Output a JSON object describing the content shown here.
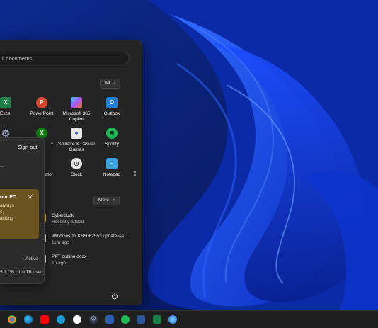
{
  "search": {
    "text": "ll documents"
  },
  "pinned": {
    "all_label": "All",
    "apps": [
      {
        "label": "Excel"
      },
      {
        "label": "PowerPoint"
      },
      {
        "label": "Microsoft 365 Copilot"
      },
      {
        "label": "Outlook"
      },
      {
        "label": "x"
      },
      {
        "label": "Solitaire & Casual Games"
      },
      {
        "label": "Spotify"
      },
      {
        "label": "ator"
      },
      {
        "label": "Clock"
      },
      {
        "label": "Notepad"
      }
    ]
  },
  "recommended": {
    "more_label": "More",
    "items": [
      {
        "title": "Cyberduck",
        "subtitle": "Recently added"
      },
      {
        "title": "Windows 11 KB5062553 update iss...",
        "subtitle": "11m ago"
      },
      {
        "title": "PPT outline.docx",
        "subtitle": "1h ago"
      }
    ]
  },
  "flyout": {
    "sign_out": "Sign out",
    "dash": "...",
    "promo_title": "our PC",
    "promo_line1": "always",
    "promo_line2": "s,",
    "promo_line3": "acking",
    "promo_line4": "",
    "status": "Active",
    "storage": "5.7 GB / 1.0 TB used"
  },
  "colors": {
    "accent": "#1a47ff",
    "menu_bg": "#242424",
    "promo_bg": "#6b5420"
  }
}
